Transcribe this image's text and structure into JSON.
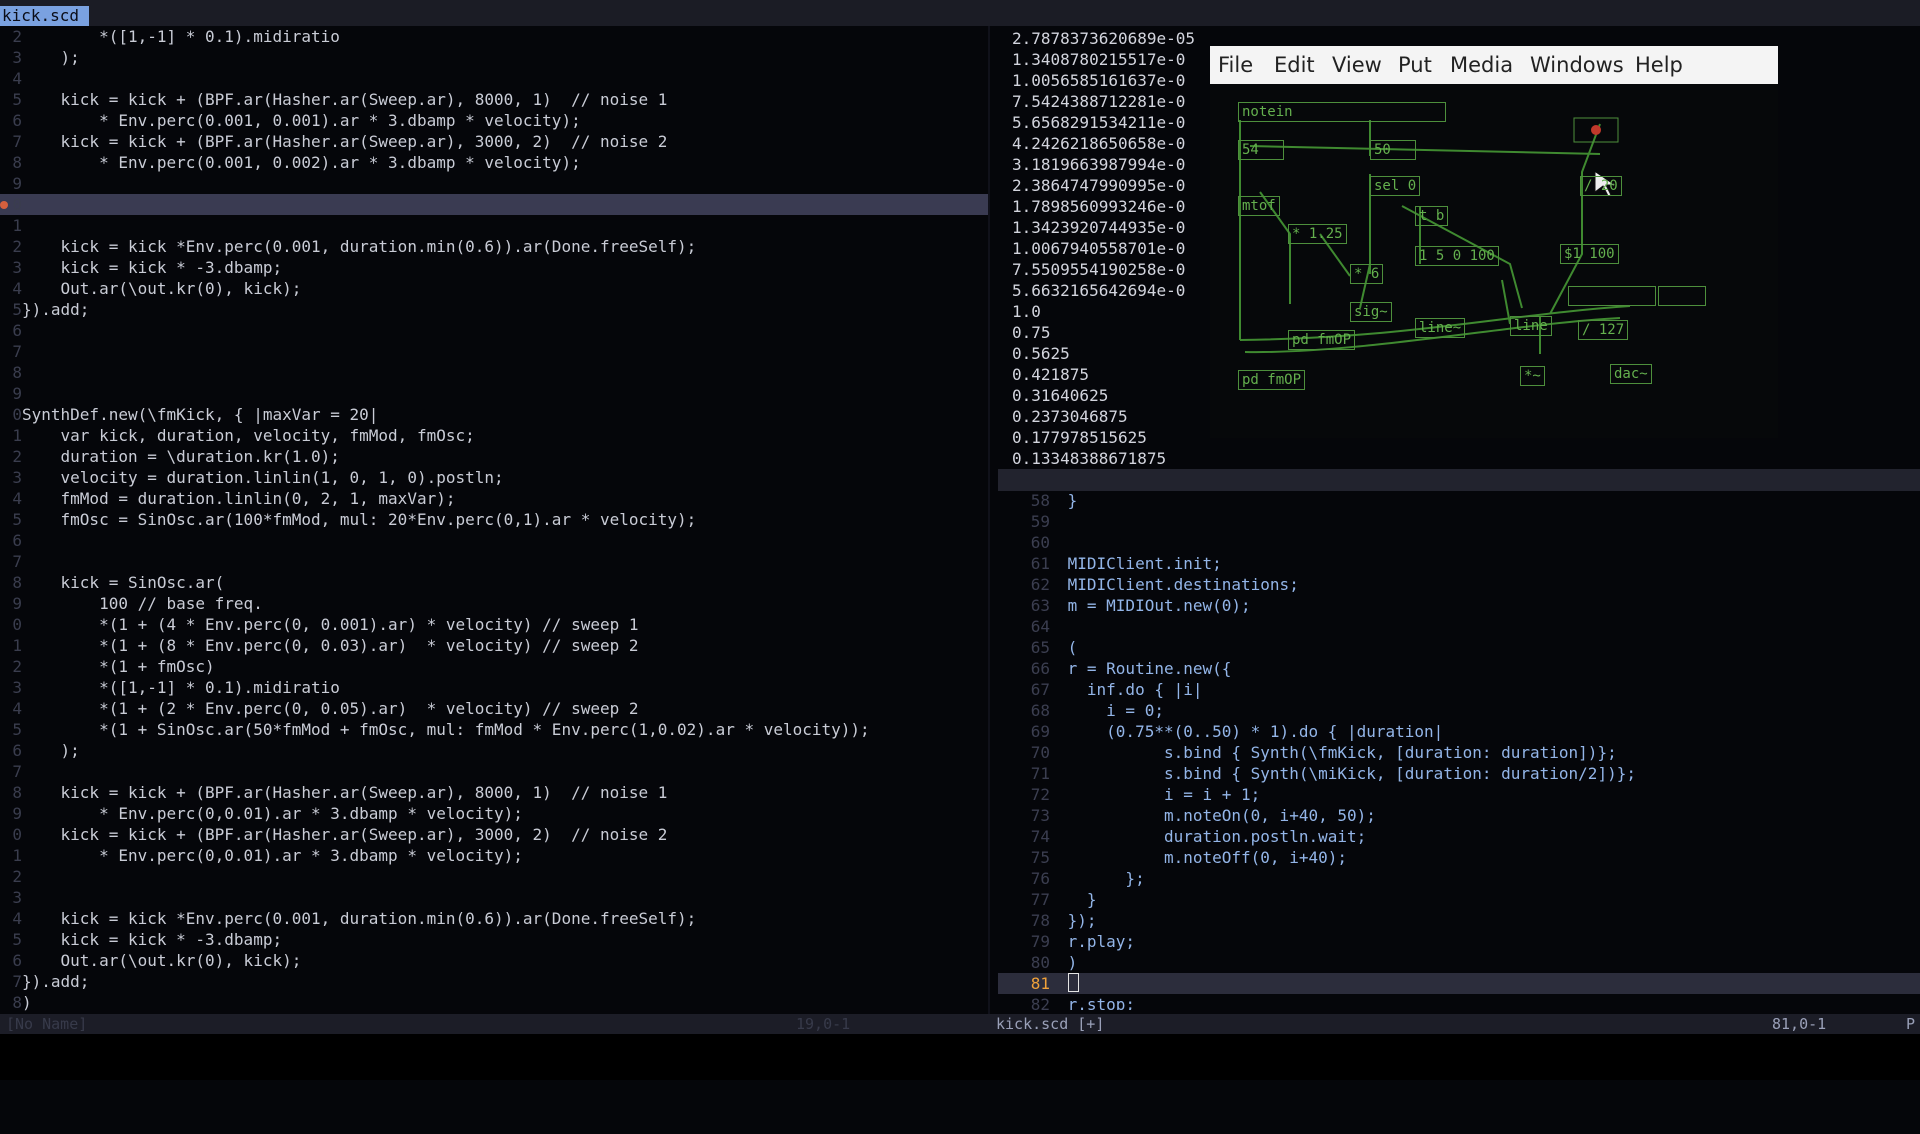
{
  "tab": {
    "active_label": "kick.scd"
  },
  "left_pane": {
    "lines": [
      {
        "num": "2",
        "code": "        *([1,-1] * 0.1).midiratio"
      },
      {
        "num": "3",
        "code": "    );"
      },
      {
        "num": "4",
        "code": ""
      },
      {
        "num": "5",
        "code": "    kick = kick + (BPF.ar(Hasher.ar(Sweep.ar), 8000, 1)  // noise 1"
      },
      {
        "num": "6",
        "code": "        * Env.perc(0.001, 0.001).ar * 3.dbamp * velocity);"
      },
      {
        "num": "7",
        "code": "    kick = kick + (BPF.ar(Hasher.ar(Sweep.ar), 3000, 2)  // noise 2"
      },
      {
        "num": "8",
        "code": "        * Env.perc(0.001, 0.002).ar * 3.dbamp * velocity);"
      },
      {
        "num": "9",
        "code": ""
      },
      {
        "num": "0",
        "code": "",
        "cursor": true
      },
      {
        "num": "1",
        "code": ""
      },
      {
        "num": "2",
        "code": "    kick = kick *Env.perc(0.001, duration.min(0.6)).ar(Done.freeSelf);"
      },
      {
        "num": "3",
        "code": "    kick = kick * -3.dbamp;"
      },
      {
        "num": "4",
        "code": "    Out.ar(\\out.kr(0), kick);"
      },
      {
        "num": "5",
        "code": "}).add;"
      },
      {
        "num": "6",
        "code": ""
      },
      {
        "num": "7",
        "code": ""
      },
      {
        "num": "8",
        "code": ""
      },
      {
        "num": "9",
        "code": ""
      },
      {
        "num": "0",
        "code": "SynthDef.new(\\fmKick, { |maxVar = 20|"
      },
      {
        "num": "1",
        "code": "    var kick, duration, velocity, fmMod, fmOsc;"
      },
      {
        "num": "2",
        "code": "    duration = \\duration.kr(1.0);"
      },
      {
        "num": "3",
        "code": "    velocity = duration.linlin(1, 0, 1, 0).postln;"
      },
      {
        "num": "4",
        "code": "    fmMod = duration.linlin(0, 2, 1, maxVar);"
      },
      {
        "num": "5",
        "code": "    fmOsc = SinOsc.ar(100*fmMod, mul: 20*Env.perc(0,1).ar * velocity);"
      },
      {
        "num": "6",
        "code": ""
      },
      {
        "num": "7",
        "code": ""
      },
      {
        "num": "8",
        "code": "    kick = SinOsc.ar("
      },
      {
        "num": "9",
        "code": "        100 // base freq."
      },
      {
        "num": "0",
        "code": "        *(1 + (4 * Env.perc(0, 0.001).ar) * velocity) // sweep 1"
      },
      {
        "num": "1",
        "code": "        *(1 + (8 * Env.perc(0, 0.03).ar)  * velocity) // sweep 2"
      },
      {
        "num": "2",
        "code": "        *(1 + fmOsc)"
      },
      {
        "num": "3",
        "code": "        *([1,-1] * 0.1).midiratio"
      },
      {
        "num": "4",
        "code": "        *(1 + (2 * Env.perc(0, 0.05).ar)  * velocity) // sweep 2"
      },
      {
        "num": "5",
        "code": "        *(1 + SinOsc.ar(50*fmMod + fmOsc, mul: fmMod * Env.perc(1,0.02).ar * velocity));"
      },
      {
        "num": "6",
        "code": "    );"
      },
      {
        "num": "7",
        "code": ""
      },
      {
        "num": "8",
        "code": "    kick = kick + (BPF.ar(Hasher.ar(Sweep.ar), 8000, 1)  // noise 1"
      },
      {
        "num": "9",
        "code": "        * Env.perc(0,0.01).ar * 3.dbamp * velocity);"
      },
      {
        "num": "0",
        "code": "    kick = kick + (BPF.ar(Hasher.ar(Sweep.ar), 3000, 2)  // noise 2"
      },
      {
        "num": "1",
        "code": "        * Env.perc(0,0.01).ar * 3.dbamp * velocity);"
      },
      {
        "num": "2",
        "code": ""
      },
      {
        "num": "3",
        "code": ""
      },
      {
        "num": "4",
        "code": "    kick = kick *Env.perc(0.001, duration.min(0.6)).ar(Done.freeSelf);"
      },
      {
        "num": "5",
        "code": "    kick = kick * -3.dbamp;"
      },
      {
        "num": "6",
        "code": "    Out.ar(\\out.kr(0), kick);"
      },
      {
        "num": "7",
        "code": "}).add;"
      },
      {
        "num": "8",
        "code": ")"
      }
    ]
  },
  "num_output": [
    "2.7878373620689e-05",
    "1.3408780215517e-0",
    "1.0056585161637e-0",
    "7.5424388712281e-0",
    "5.6568291534211e-0",
    "4.2426218650658e-0",
    "3.1819663987994e-0",
    "2.3864747990995e-0",
    "1.7898560993246e-0",
    "1.3423920744935e-0",
    "1.0067940558701e-0",
    "7.5509554190258e-0",
    "5.6632165642694e-0",
    "1.0",
    "0.75",
    "0.5625",
    "0.421875",
    "0.31640625",
    "0.2373046875",
    "0.177978515625",
    "0.13348388671875"
  ],
  "pd_window": {
    "menus": [
      "File",
      "Edit",
      "View",
      "Put",
      "Media",
      "Windows",
      "Help"
    ],
    "objects": [
      {
        "id": "notein",
        "label": "notein"
      },
      {
        "id": "num-54",
        "label": "54"
      },
      {
        "id": "num-50",
        "label": "50"
      },
      {
        "id": "sel-0",
        "label": "sel 0"
      },
      {
        "id": "bang",
        "label": ""
      },
      {
        "id": "div-20",
        "label": "/ 20"
      },
      {
        "id": "mtof",
        "label": "mtof"
      },
      {
        "id": "t-b",
        "label": "t b"
      },
      {
        "id": "mul-125",
        "label": "* 1.25"
      },
      {
        "id": "msg-6",
        "label": "* 6"
      },
      {
        "id": "msg-1-5-0-100",
        "label": "1 5 0 100"
      },
      {
        "id": "msg-1-100",
        "label": "$1 100"
      },
      {
        "id": "sig",
        "label": "sig~"
      },
      {
        "id": "line-tilde",
        "label": "line~"
      },
      {
        "id": "line",
        "label": "line"
      },
      {
        "id": "div-127",
        "label": "/ 127"
      },
      {
        "id": "pd-fmop-1",
        "label": "pd fmOP"
      },
      {
        "id": "pd-fmop-2",
        "label": "pd fmOP"
      },
      {
        "id": "mul-tilde",
        "label": "*~"
      },
      {
        "id": "dac",
        "label": "dac~"
      }
    ]
  },
  "right_pane": {
    "lines": [
      {
        "num": "58",
        "code": " }"
      },
      {
        "num": "59",
        "code": ""
      },
      {
        "num": "60",
        "code": ""
      },
      {
        "num": "61",
        "code": " MIDIClient.init;"
      },
      {
        "num": "62",
        "code": " MIDIClient.destinations;"
      },
      {
        "num": "63",
        "code": " m = MIDIOut.new(0);"
      },
      {
        "num": "64",
        "code": ""
      },
      {
        "num": "65",
        "code": " ("
      },
      {
        "num": "66",
        "code": " r = Routine.new({"
      },
      {
        "num": "67",
        "code": "   inf.do { |i|"
      },
      {
        "num": "68",
        "code": "     i = 0;"
      },
      {
        "num": "69",
        "code": "     (0.75**(0..50) * 1).do { |duration|"
      },
      {
        "num": "70",
        "code": "           s.bind { Synth(\\fmKick, [duration: duration])};"
      },
      {
        "num": "71",
        "code": "           s.bind { Synth(\\miKick, [duration: duration/2])};"
      },
      {
        "num": "72",
        "code": "           i = i + 1;"
      },
      {
        "num": "73",
        "code": "           m.noteOn(0, i+40, 50);"
      },
      {
        "num": "74",
        "code": "           duration.postln.wait;"
      },
      {
        "num": "75",
        "code": "           m.noteOff(0, i+40);"
      },
      {
        "num": "76",
        "code": "       };"
      },
      {
        "num": "77",
        "code": "   }"
      },
      {
        "num": "78",
        "code": " });"
      },
      {
        "num": "79",
        "code": " r.play;"
      },
      {
        "num": "80",
        "code": " )"
      },
      {
        "num": "81",
        "code": " ",
        "cursor": true
      },
      {
        "num": "82",
        "code": " r.stop;"
      }
    ]
  },
  "statusbar": {
    "left": "[No Name]",
    "mid": "19,0-1",
    "file": "kick.scd [+]",
    "pos": "81,0-1",
    "edge": "P"
  },
  "colors": {
    "accent": "#7aa1e0",
    "pd_green": "#64b04e",
    "cursor_line": "#3a3b52"
  }
}
